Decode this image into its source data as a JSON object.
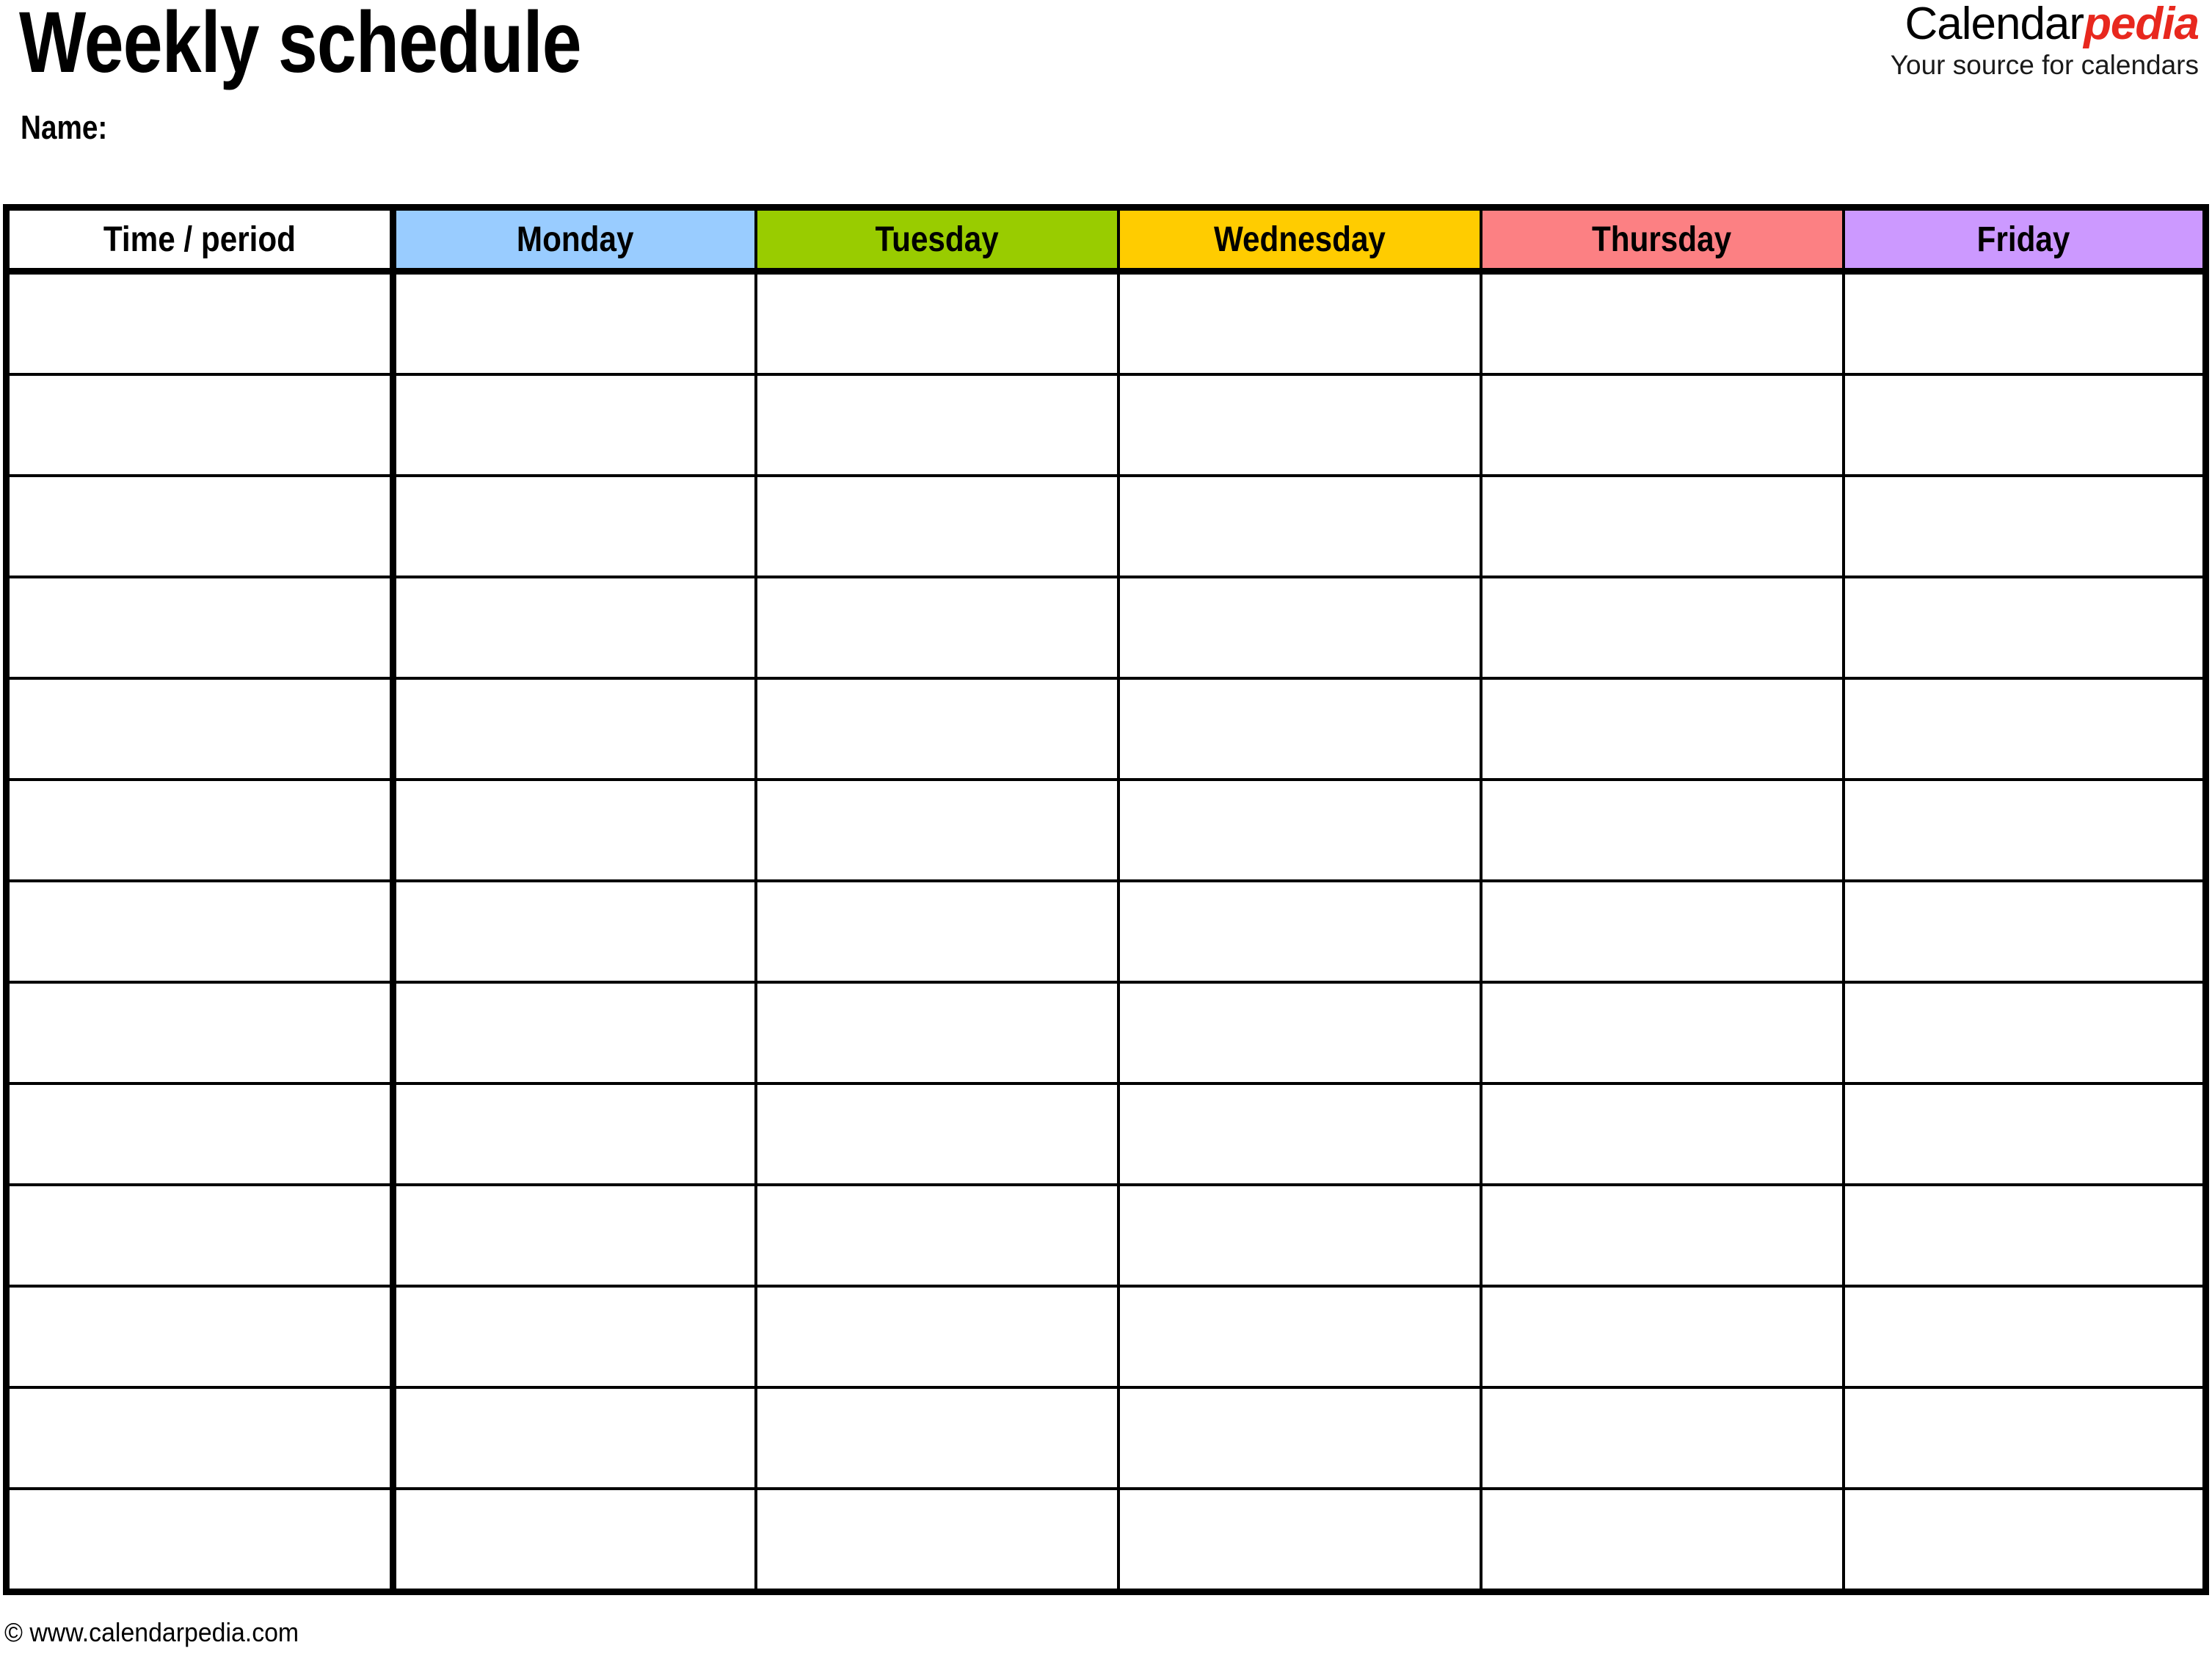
{
  "document": {
    "title": "Weekly schedule",
    "name_label": "Name:"
  },
  "brand": {
    "word_first": "Calendar",
    "word_second": "pedia",
    "tagline": "Your source for calendars",
    "accent_color": "#e8281e"
  },
  "footer": {
    "copyright": "© www.calendarpedia.com"
  },
  "table": {
    "columns": [
      {
        "label": "Time / period",
        "color": "#ffffff",
        "kind": "time"
      },
      {
        "label": "Monday",
        "color": "#99ccff",
        "kind": "day"
      },
      {
        "label": "Tuesday",
        "color": "#99cc00",
        "kind": "day"
      },
      {
        "label": "Wednesday",
        "color": "#ffcc00",
        "kind": "day"
      },
      {
        "label": "Thursday",
        "color": "#fc8083",
        "kind": "day"
      },
      {
        "label": "Friday",
        "color": "#cc99ff",
        "kind": "day"
      }
    ],
    "row_count": 13,
    "rows": [
      {
        "time": "",
        "monday": "",
        "tuesday": "",
        "wednesday": "",
        "thursday": "",
        "friday": ""
      },
      {
        "time": "",
        "monday": "",
        "tuesday": "",
        "wednesday": "",
        "thursday": "",
        "friday": ""
      },
      {
        "time": "",
        "monday": "",
        "tuesday": "",
        "wednesday": "",
        "thursday": "",
        "friday": ""
      },
      {
        "time": "",
        "monday": "",
        "tuesday": "",
        "wednesday": "",
        "thursday": "",
        "friday": ""
      },
      {
        "time": "",
        "monday": "",
        "tuesday": "",
        "wednesday": "",
        "thursday": "",
        "friday": ""
      },
      {
        "time": "",
        "monday": "",
        "tuesday": "",
        "wednesday": "",
        "thursday": "",
        "friday": ""
      },
      {
        "time": "",
        "monday": "",
        "tuesday": "",
        "wednesday": "",
        "thursday": "",
        "friday": ""
      },
      {
        "time": "",
        "monday": "",
        "tuesday": "",
        "wednesday": "",
        "thursday": "",
        "friday": ""
      },
      {
        "time": "",
        "monday": "",
        "tuesday": "",
        "wednesday": "",
        "thursday": "",
        "friday": ""
      },
      {
        "time": "",
        "monday": "",
        "tuesday": "",
        "wednesday": "",
        "thursday": "",
        "friday": ""
      },
      {
        "time": "",
        "monday": "",
        "tuesday": "",
        "wednesday": "",
        "thursday": "",
        "friday": ""
      },
      {
        "time": "",
        "monday": "",
        "tuesday": "",
        "wednesday": "",
        "thursday": "",
        "friday": ""
      },
      {
        "time": "",
        "monday": "",
        "tuesday": "",
        "wednesday": "",
        "thursday": "",
        "friday": ""
      }
    ]
  }
}
